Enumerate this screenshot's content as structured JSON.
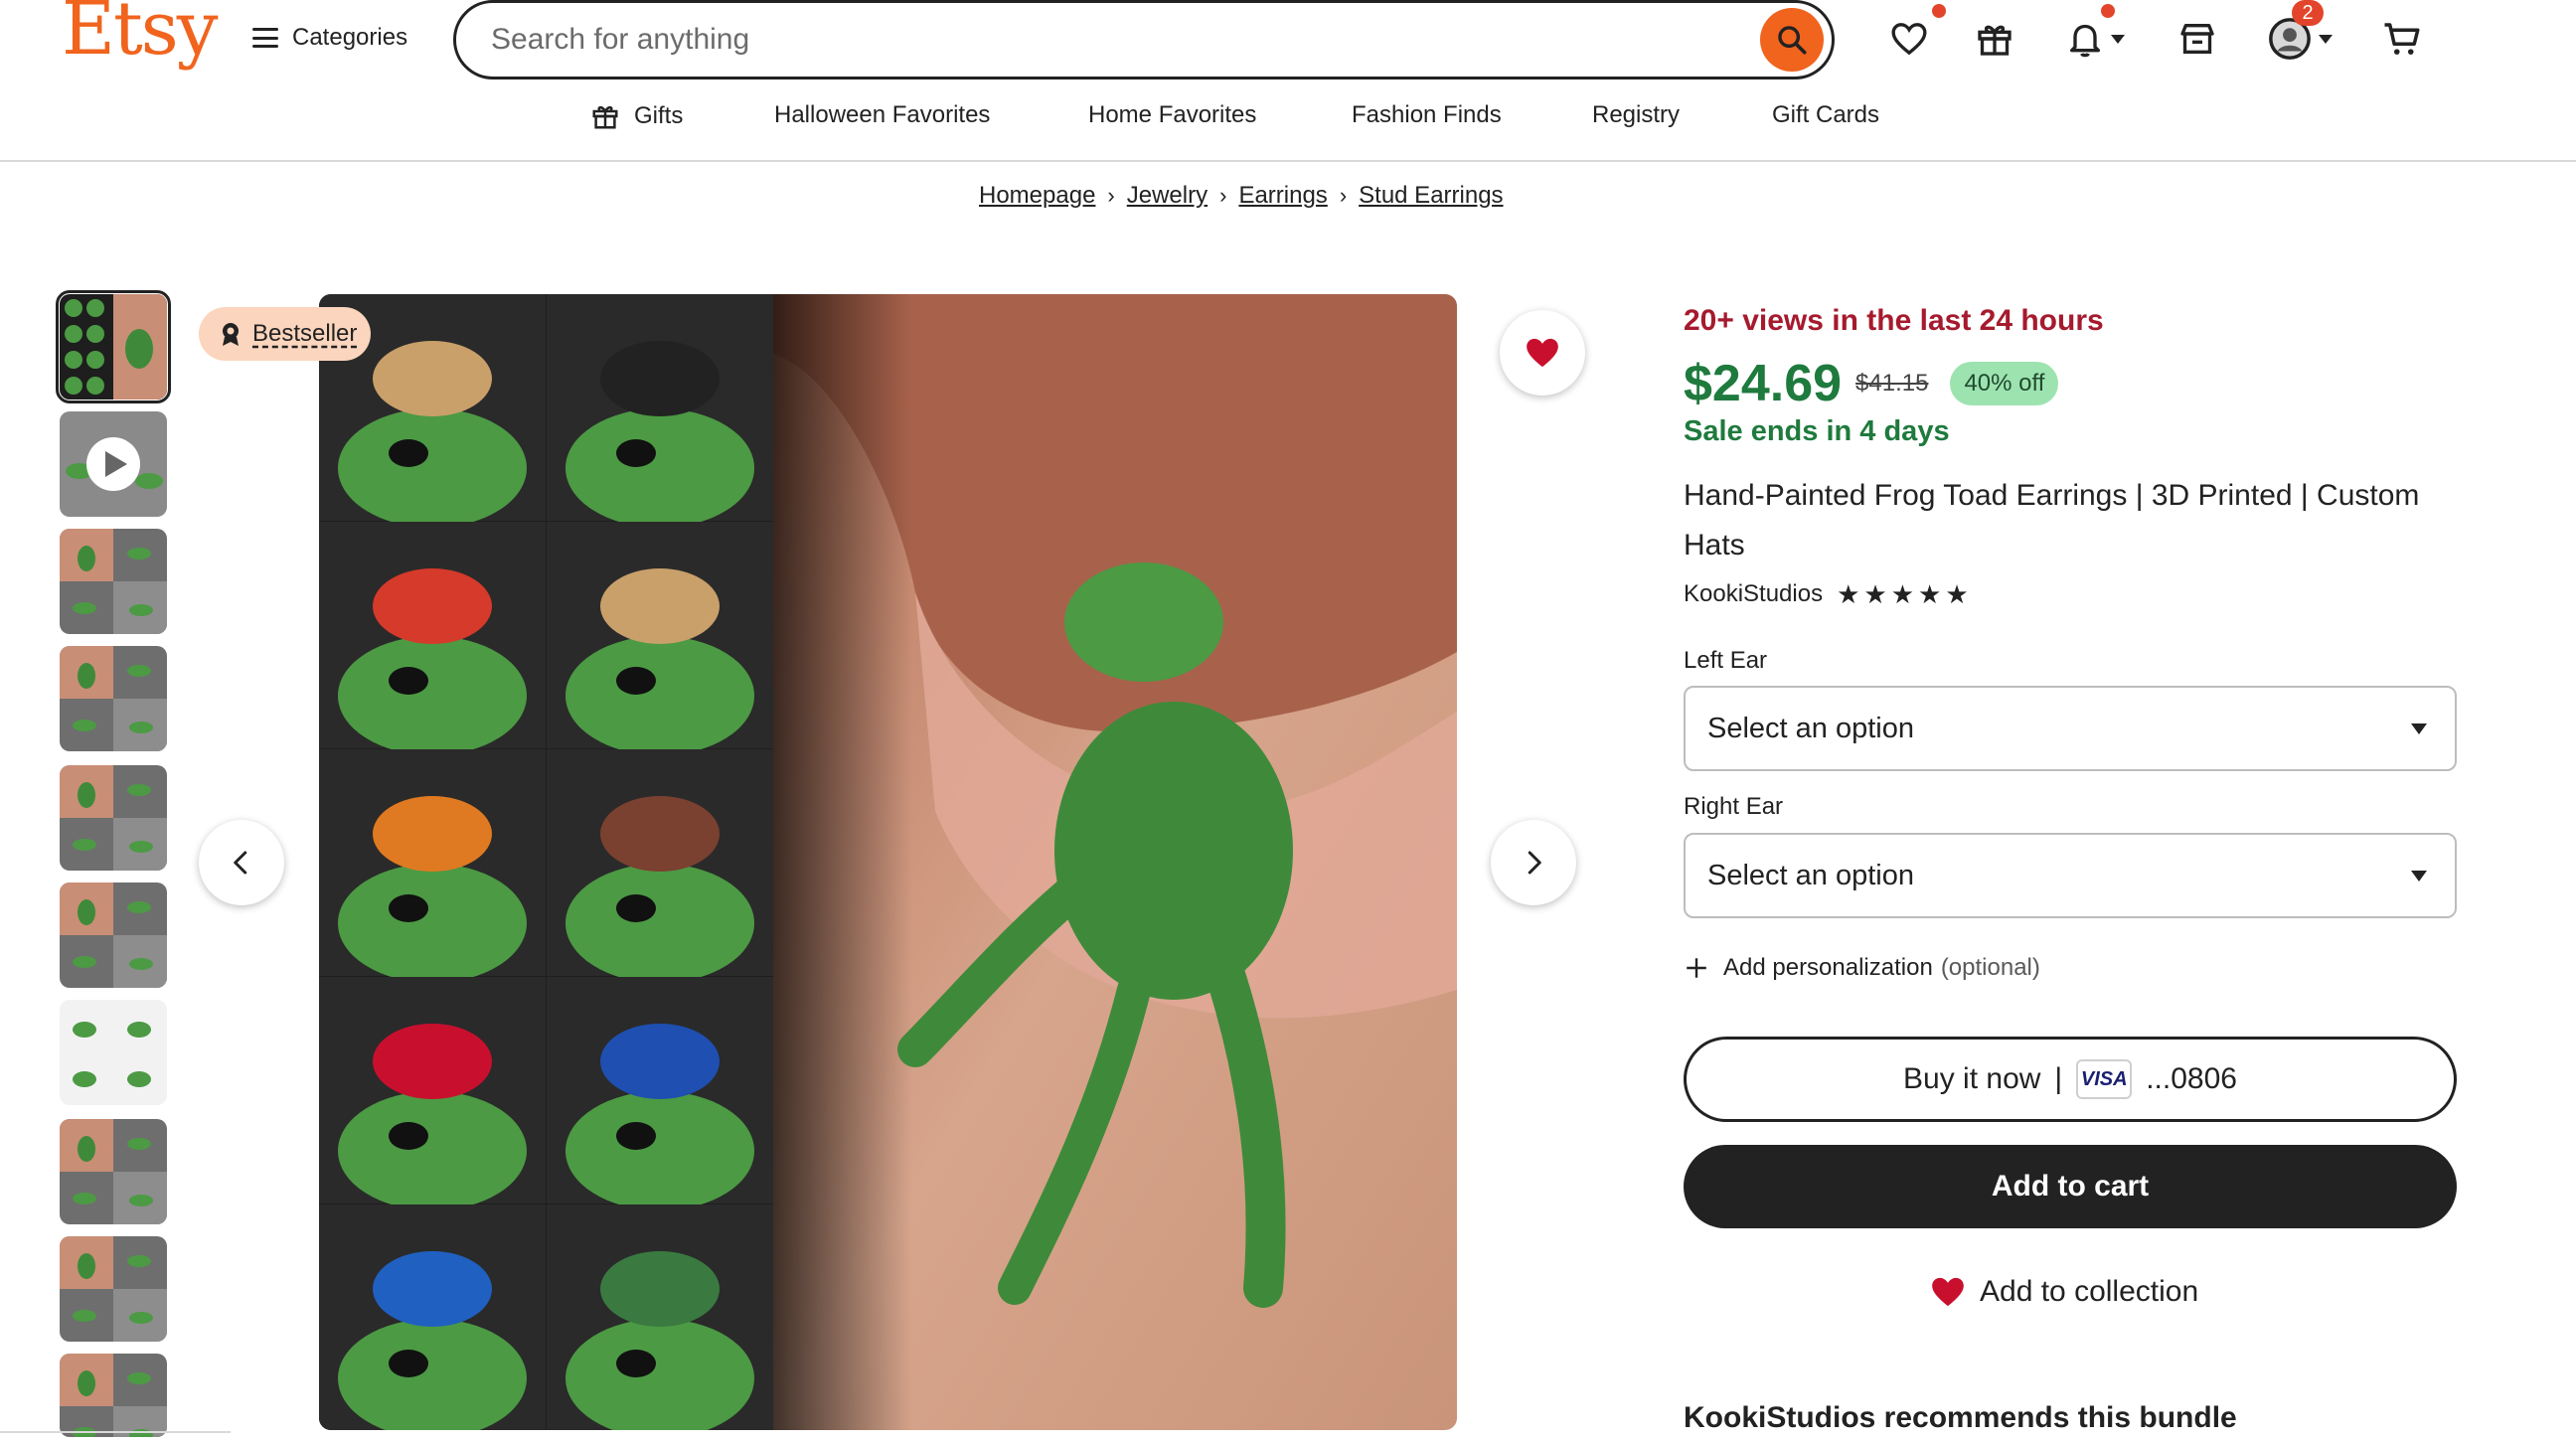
{
  "header": {
    "logo": "Etsy",
    "categories_label": "Categories",
    "search_placeholder": "Search for anything",
    "cart_badge": "2"
  },
  "subnav": [
    "Gifts",
    "Halloween Favorites",
    "Home Favorites",
    "Fashion Finds",
    "Registry",
    "Gift Cards"
  ],
  "breadcrumb": [
    "Homepage",
    "Jewelry",
    "Earrings",
    "Stud Earrings"
  ],
  "gallery": {
    "badge": "Bestseller",
    "thumbnail_count": 10
  },
  "product": {
    "views": "20+ views in the last 24 hours",
    "price": "$24.69",
    "original_price": "$41.15",
    "discount": "40% off",
    "sale_ends": "Sale ends in 4 days",
    "title": "Hand-Painted Frog Toad Earrings | 3D Printed | Custom Hats",
    "shop_name": "KookiStudios",
    "rating_stars": 5
  },
  "options": {
    "left_ear_label": "Left Ear",
    "left_ear_value": "Select an option",
    "right_ear_label": "Right Ear",
    "right_ear_value": "Select an option",
    "personalization_label": "Add personalization",
    "personalization_optional": "(optional)"
  },
  "actions": {
    "buy_now": "Buy it now",
    "buy_now_sep": "|",
    "card_brand": "VISA",
    "card_last4": "...0806",
    "add_to_cart": "Add to cart",
    "add_to_collection": "Add to collection"
  },
  "bundle_heading": "KookiStudios recommends this bundle",
  "colors": {
    "brand": "#f1641e",
    "price_green": "#1f7a3d",
    "views_red": "#a61a2e",
    "discount_bg": "#9de3b0",
    "bestseller_bg": "#fbd5bd",
    "heart": "#c8102e"
  },
  "icons": [
    "search-icon",
    "heart-icon",
    "gift-icon",
    "bell-icon",
    "shop-icon",
    "account-icon",
    "cart-icon",
    "award-icon",
    "play-icon",
    "chevron-left-icon",
    "chevron-right-icon",
    "plus-icon"
  ]
}
